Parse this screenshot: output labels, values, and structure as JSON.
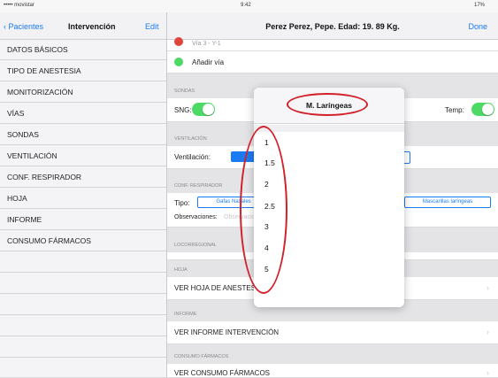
{
  "status_bar": {
    "carrier": "••••• movistar",
    "time": "9:42",
    "battery": "17%"
  },
  "sidebar": {
    "back_label": "Pacientes",
    "title": "Intervención",
    "edit_label": "Edit",
    "items": [
      {
        "label": "DATOS BÁSICOS"
      },
      {
        "label": "TIPO DE ANESTESIA"
      },
      {
        "label": "MONITORIZACIÓN"
      },
      {
        "label": "VÍAS"
      },
      {
        "label": "SONDAS"
      },
      {
        "label": "VENTILACIÓN"
      },
      {
        "label": "CONF. RESPIRADOR"
      },
      {
        "label": "HOJA"
      },
      {
        "label": "INFORME"
      },
      {
        "label": "CONSUMO FÁRMACOS"
      }
    ]
  },
  "header": {
    "title": "Perez Perez, Pepe. Edad: 19. 89 Kg.",
    "done_label": "Done"
  },
  "main": {
    "top_partial": "Vía 3 - Y-1",
    "add_via": "Añadir vía",
    "sondas_section": "SONDAS",
    "sng_label": "SNG:",
    "temp_label": "Temp:",
    "ventilacion_section": "VENTILACIÓN",
    "ventilacion_label": "Ventilación:",
    "conf_section": "CONF. RESPIRADOR",
    "tipo_label": "Tipo:",
    "tipo_segment_1": "Gafas Nasales",
    "tipo_segment_2": "Mascarillas laríngeas",
    "observaciones_label": "Observaciones:",
    "observaciones_placeholder": "Observaciones",
    "locorregional_section": "LOCORREGIONAL",
    "hoja_section": "HOJA",
    "ver_hoja": "VER HOJA DE ANESTESIA",
    "informe_section": "INFORME",
    "ver_informe": "VER INFORME INTERVENCIÓN",
    "consumo_section": "CONSUMO FÁRMACOS",
    "ver_consumo": "VER CONSUMO FÁRMACOS"
  },
  "popover": {
    "title": "M. Laríngeas",
    "options": [
      "1",
      "1.5",
      "2",
      "2.5",
      "3",
      "4",
      "5"
    ]
  },
  "colors": {
    "accent": "#1a7bf2",
    "toggle_on": "#4cd964",
    "annotation": "#d2202a"
  }
}
